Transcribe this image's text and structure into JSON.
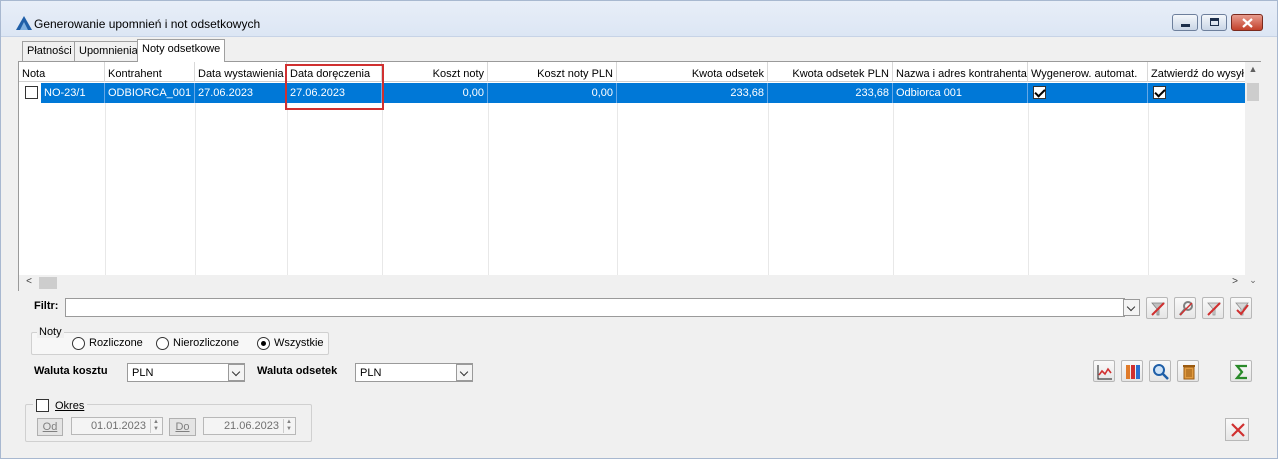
{
  "window": {
    "title": "Generowanie upomnień i not odsetkowych"
  },
  "tabs": [
    {
      "label": "Płatności"
    },
    {
      "label": "Upomnienia"
    },
    {
      "label": "Noty odsetkowe",
      "active": true
    }
  ],
  "grid": {
    "columns": [
      {
        "label": "Nota"
      },
      {
        "label": "Kontrahent"
      },
      {
        "label": "Data wystawienia"
      },
      {
        "label": "Data doręczenia"
      },
      {
        "label": "Koszt noty"
      },
      {
        "label": "Koszt noty PLN"
      },
      {
        "label": "Kwota odsetek"
      },
      {
        "label": "Kwota odsetek PLN"
      },
      {
        "label": "Nazwa i adres kontrahenta"
      },
      {
        "label": "Wygenerow. automat."
      },
      {
        "label": "Zatwierdź do wysył"
      }
    ],
    "rows": [
      {
        "selected_checkbox": false,
        "nota": "NO-23/1",
        "kontrahent": "ODBIORCA_001",
        "data_wystawienia": "27.06.2023",
        "data_doreczenia": "27.06.2023",
        "koszt_noty": "0,00",
        "koszt_noty_pln": "0,00",
        "kwota_odsetek": "233,68",
        "kwota_odsetek_pln": "233,68",
        "nazwa_adres": "Odbiorca 001",
        "wygenerow_automat": true,
        "zatwierdz": true
      }
    ]
  },
  "filter": {
    "label": "Filtr:",
    "value": ""
  },
  "noty_group": {
    "label": "Noty",
    "options": [
      {
        "label": "Rozliczone",
        "selected": false
      },
      {
        "label": "Nierozliczone",
        "selected": false
      },
      {
        "label": "Wszystkie",
        "selected": true
      }
    ]
  },
  "currency": {
    "koszt_label": "Waluta kosztu",
    "koszt_value": "PLN",
    "odsetek_label": "Waluta odsetek",
    "odsetek_value": "PLN"
  },
  "okres": {
    "label": "Okres",
    "checked": false,
    "od_label": "Od",
    "od_value": "01.01.2023",
    "do_label": "Do",
    "do_value": "21.06.2023"
  },
  "colors": {
    "selection": "#0078d7",
    "highlight_border": "#d03030",
    "close_red": "#d03030"
  }
}
